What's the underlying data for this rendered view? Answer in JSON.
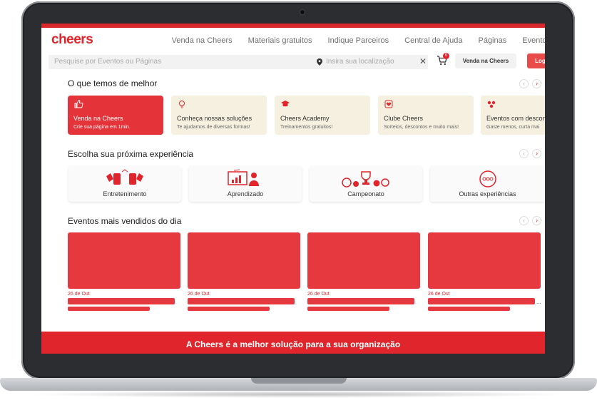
{
  "brand": {
    "logo": "cheers",
    "accent": "#e0262c"
  },
  "nav": {
    "items": [
      "Venda na Cheers",
      "Materiais gratuitos",
      "Indique Parceiros",
      "Central de Ajuda",
      "Páginas",
      "Eventos"
    ]
  },
  "search": {
    "placeholder": "Pesquise por Eventos ou Páginas",
    "location_placeholder": "Insira sua localização",
    "cart_count": "0",
    "sell_button": "Venda na Cheers",
    "login_button": "Login"
  },
  "best": {
    "title": "O que temos de melhor",
    "cards": [
      {
        "title": "Venda na Cheers",
        "subtitle": "Crie sua página em 1min.",
        "icon": "thumbs-up-icon"
      },
      {
        "title": "Conheça nossas soluções",
        "subtitle": "Te ajudamos de diversas formas!",
        "icon": "lightbulb-icon"
      },
      {
        "title": "Cheers Academy",
        "subtitle": "Treinamentos gratuitos!",
        "icon": "graduation-cap-icon"
      },
      {
        "title": "Clube Cheers",
        "subtitle": "Sorteios, descontos e muito mais!",
        "icon": "heart-badge-icon"
      },
      {
        "title": "Eventos com descon",
        "subtitle": "Gaste menos, curta mai",
        "icon": "dots-icon"
      }
    ]
  },
  "experience": {
    "title": "Escolha sua próxima experiência",
    "cards": [
      {
        "label": "Entretenimento",
        "icon": "cheers-drinks-icon"
      },
      {
        "label": "Aprendizado",
        "icon": "presentation-icon"
      },
      {
        "label": "Campeonato",
        "icon": "trophy-balls-icon"
      },
      {
        "label": "Outras experiências",
        "icon": "more-dots-icon"
      }
    ]
  },
  "events": {
    "title": "Eventos mais vendidos do dia",
    "cards": [
      {
        "date": "26 de Out"
      },
      {
        "date": "26 de Out"
      },
      {
        "date": "26 de Out"
      },
      {
        "date": "26 de Out"
      }
    ],
    "ellipsis": "..."
  },
  "footer": {
    "text": "A Cheers é a melhor solução para a sua organização"
  }
}
